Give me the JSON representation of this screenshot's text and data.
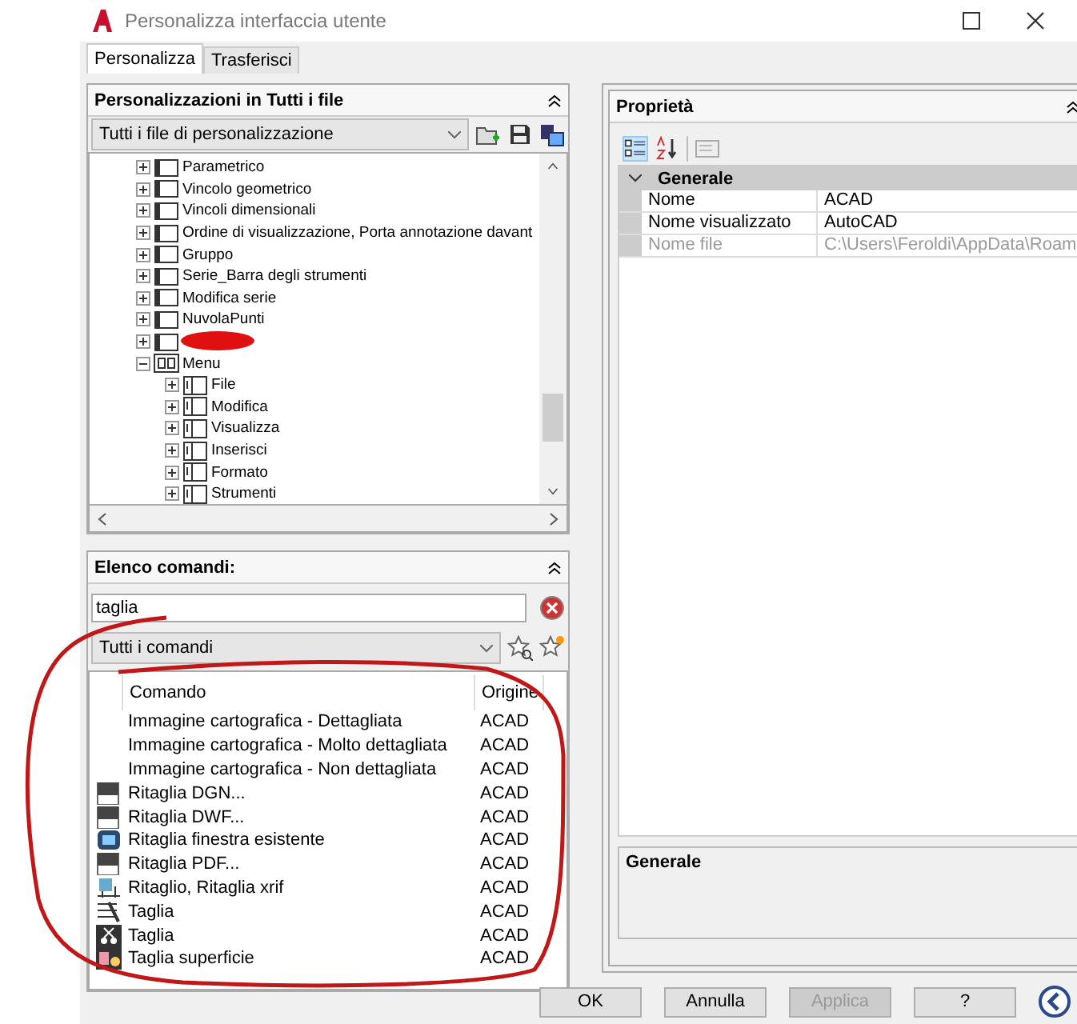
{
  "window": {
    "title": "Personalizza interfaccia utente"
  },
  "tabs": [
    {
      "label": "Personalizza",
      "selected": true
    },
    {
      "label": "Trasferisci",
      "selected": false
    }
  ],
  "customizations": {
    "title": "Personalizzazioni in Tutti i file",
    "file_select": "Tutti i file di personalizzazione",
    "tree": [
      {
        "label": "Parametrico",
        "kind": "toolbar",
        "expanded": false
      },
      {
        "label": "Vincolo geometrico",
        "kind": "toolbar",
        "expanded": false
      },
      {
        "label": "Vincoli dimensionali",
        "kind": "toolbar",
        "expanded": false
      },
      {
        "label": "Ordine di visualizzazione, Porta annotazione davant",
        "kind": "toolbar",
        "expanded": false
      },
      {
        "label": "Gruppo",
        "kind": "toolbar",
        "expanded": false
      },
      {
        "label": "Serie_Barra degli strumenti",
        "kind": "toolbar",
        "expanded": false
      },
      {
        "label": "Modifica serie",
        "kind": "toolbar",
        "expanded": false
      },
      {
        "label": "NuvolaPunti",
        "kind": "toolbar",
        "expanded": false
      },
      {
        "kind": "toolbar",
        "expanded": false
      },
      {
        "label": "Menu",
        "kind": "menus",
        "expanded": true,
        "children": [
          {
            "label": "File",
            "kind": "menu",
            "expanded": false
          },
          {
            "label": "Modifica",
            "kind": "menu",
            "expanded": false
          },
          {
            "label": "Visualizza",
            "kind": "menu",
            "expanded": false
          },
          {
            "label": "Inserisci",
            "kind": "menu",
            "expanded": false
          },
          {
            "label": "Formato",
            "kind": "menu",
            "expanded": false
          },
          {
            "label": "Strumenti",
            "kind": "menu",
            "expanded": false
          }
        ]
      }
    ]
  },
  "commands": {
    "title": "Elenco comandi:",
    "search": {
      "value": "taglia"
    },
    "filter": "Tutti i comandi",
    "columns": [
      "Comando",
      "Origine"
    ],
    "rows": [
      {
        "name": "Immagine cartografica - Dettagliata",
        "origin": "ACAD"
      },
      {
        "name": "Immagine cartografica - Molto dettagliata",
        "origin": "ACAD"
      },
      {
        "name": "Immagine cartografica - Non dettagliata",
        "origin": "ACAD"
      },
      {
        "name": "Ritaglia DGN...",
        "origin": "ACAD",
        "kind": "document"
      },
      {
        "name": "Ritaglia DWF...",
        "origin": "ACAD",
        "kind": "document"
      },
      {
        "name": "Ritaglia finestra esistente",
        "origin": "ACAD",
        "kind": "monitor"
      },
      {
        "name": "Ritaglia PDF...",
        "origin": "ACAD",
        "kind": "document"
      },
      {
        "name": "Ritaglio, Ritaglia xrif",
        "origin": "ACAD",
        "kind": "xref"
      },
      {
        "name": "Taglia",
        "origin": "ACAD",
        "kind": "trim"
      },
      {
        "name": "Taglia",
        "origin": "ACAD",
        "kind": "scissors"
      },
      {
        "name": "Taglia superficie",
        "origin": "ACAD",
        "kind": "surface"
      }
    ]
  },
  "properties": {
    "title": "Proprietà",
    "category": {
      "label": "Generale",
      "expanded": true
    },
    "rows": [
      {
        "name": "Nome",
        "value": "ACAD",
        "disabled": false
      },
      {
        "name": "Nome visualizzato",
        "value": "AutoCAD",
        "disabled": false
      },
      {
        "name": "Nome file",
        "value": "C:\\Users\\Feroldi\\AppData\\Roam",
        "disabled": true
      }
    ],
    "description_title": "Generale"
  },
  "buttons": [
    {
      "label": "OK",
      "disabled": false
    },
    {
      "label": "Annulla",
      "disabled": false
    },
    {
      "label": "Applica",
      "disabled": true
    },
    {
      "label": "?",
      "disabled": false
    }
  ]
}
